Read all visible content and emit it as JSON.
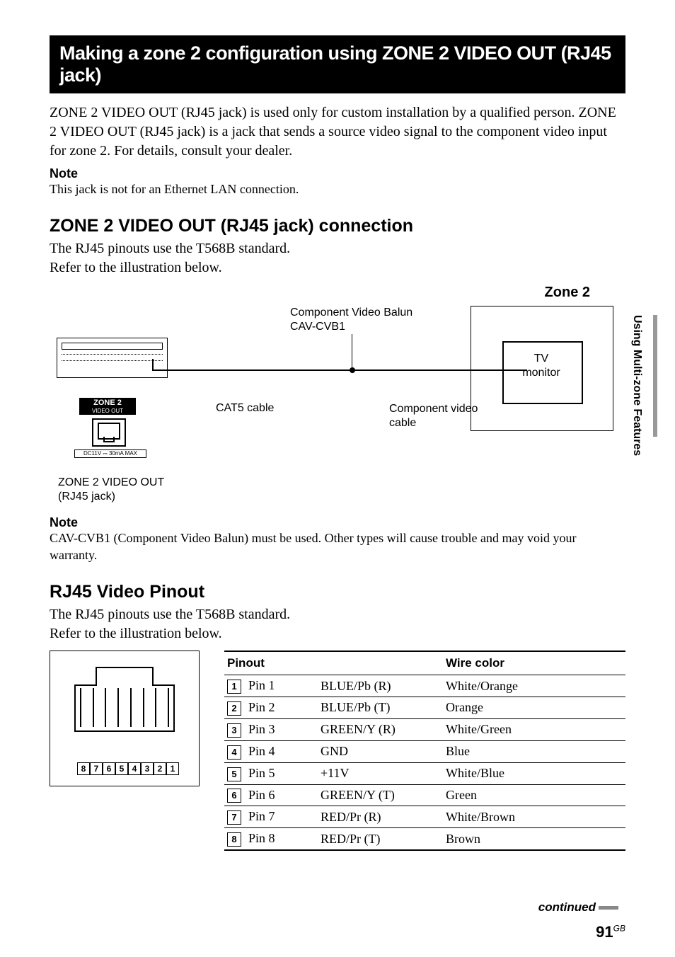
{
  "sidebar": {
    "section_title": "Using Multi-zone Features"
  },
  "title": "Making a zone 2 configuration using ZONE 2 VIDEO OUT (RJ45 jack)",
  "intro": "ZONE 2 VIDEO OUT (RJ45 jack) is used only for custom installation by a qualified person. ZONE 2 VIDEO OUT (RJ45 jack) is a jack that sends a source video signal to the component video input for zone 2. For details, consult your dealer.",
  "note1_head": "Note",
  "note1_body": "This jack is not for an Ethernet LAN connection.",
  "h2a": "ZONE 2 VIDEO OUT (RJ45 jack) connection",
  "h2a_body1": "The RJ45 pinouts use the T568B standard.",
  "h2a_body2": "Refer to the illustration below.",
  "diagram": {
    "zone_label": "Zone 2",
    "balun_l1": "Component Video Balun",
    "balun_l2": "CAV-CVB1",
    "cat5": "CAT5 cable",
    "comp_l1": "Component video",
    "comp_l2": "cable",
    "tv_l1": "TV",
    "tv_l2": "monitor",
    "port_l1": "ZONE 2",
    "port_l2": "VIDEO OUT",
    "dc": "DC11V ⎓ 30mA MAX",
    "out_l1": "ZONE 2 VIDEO OUT",
    "out_l2": "(RJ45 jack)"
  },
  "note2_head": "Note",
  "note2_body": "CAV-CVB1 (Component Video Balun) must be used. Other types will cause trouble and may void your warranty.",
  "h2b": "RJ45 Video Pinout",
  "h2b_body1": "The RJ45 pinouts use the T568B standard.",
  "h2b_body2": "Refer to the illustration below.",
  "jack_numbers": [
    "8",
    "7",
    "6",
    "5",
    "4",
    "3",
    "2",
    "1"
  ],
  "table": {
    "headers": {
      "c1": "Pinout",
      "c2": "",
      "c3": "Wire color"
    },
    "rows": [
      {
        "num": "1",
        "pin": "Pin 1",
        "signal": "BLUE/Pb (R)",
        "color": "White/Orange"
      },
      {
        "num": "2",
        "pin": "Pin 2",
        "signal": "BLUE/Pb (T)",
        "color": "Orange"
      },
      {
        "num": "3",
        "pin": "Pin 3",
        "signal": "GREEN/Y (R)",
        "color": "White/Green"
      },
      {
        "num": "4",
        "pin": "Pin 4",
        "signal": "GND",
        "color": "Blue"
      },
      {
        "num": "5",
        "pin": "Pin 5",
        "signal": "+11V",
        "color": "White/Blue"
      },
      {
        "num": "6",
        "pin": "Pin 6",
        "signal": "GREEN/Y (T)",
        "color": "Green"
      },
      {
        "num": "7",
        "pin": "Pin 7",
        "signal": "RED/Pr (R)",
        "color": "White/Brown"
      },
      {
        "num": "8",
        "pin": "Pin 8",
        "signal": "RED/Pr (T)",
        "color": "Brown"
      }
    ]
  },
  "continued": "continued",
  "page_number": "91",
  "page_suffix": "GB"
}
